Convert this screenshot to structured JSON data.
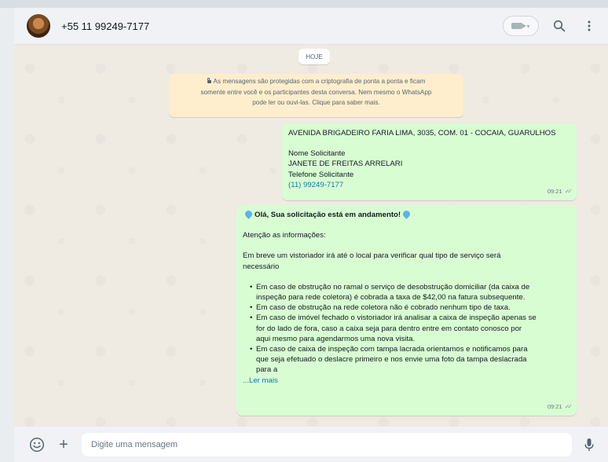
{
  "header": {
    "contact_name": "+55 11 99249-7177",
    "icons": [
      "avatar",
      "video-call-icon",
      "chevron-down-icon",
      "search-icon",
      "menu-icon"
    ]
  },
  "chat": {
    "date_chip": "HOJE",
    "encryption_notice": {
      "line1": "As mensagens são protegidas com a criptografia de ponta a ponta e ficam",
      "line2": "somente entre você e os participantes desta conversa. Nem mesmo o WhatsApp",
      "line3": "pode ler ou ouvi-las. Clique para saber mais."
    },
    "message1": {
      "line1": "AVENIDA BRIGADEIRO FARIA LIMA, 3035, COM. 01 - COCAIA, GUARULHOS",
      "line2": "Nome Solicitante",
      "line3": "JANETE DE FREITAS ARRELARI",
      "line4": "Telefone Solicitante",
      "phone_link": "(11) 99249-7177",
      "time": "09:21"
    },
    "message2": {
      "title": "Olá, Sua solicitação está em andamento!",
      "attention": "Atenção as informações:",
      "para1_line1": "Em breve um vistoriador irá até o local para verificar qual tipo de serviço será",
      "para1_line2": "necessário",
      "bullets": [
        {
          "l1": "Em caso de obstrução no ramal o serviço de desobstrução domiciliar (da caixa de",
          "l2": "inspeção para rede coletora) é cobrada a taxa de $42,00 na fatura subsequente."
        },
        {
          "l1": "Em caso de obstrução na rede coletora não é cobrado nenhum tipo de taxa."
        },
        {
          "l1": "Em caso de imóvel fechado o vistoriador irá analisar a caixa de inspeção apenas se",
          "l2": "for do lado de fora, caso a caixa seja para dentro entre em contato conosco por",
          "l3": "aqui mesmo para agendarmos uma nova visita."
        },
        {
          "l1": "Em caso de caixa de inspeção com tampa lacrada orientamos e notificamos para",
          "l2": "que seja efetuado o deslacre primeiro e nos envie uma foto da tampa deslacrada",
          "l3": "para a"
        }
      ],
      "read_more": "...Ler mais",
      "time": "09:21"
    }
  },
  "footer": {
    "input_placeholder": "Digite uma mensagem",
    "icons": [
      "emoji-icon",
      "plus-icon",
      "mic-icon"
    ]
  },
  "colors": {
    "outgoing_bubble": "#d9fdd3",
    "chat_background": "#efeae2",
    "link": "#027eb5",
    "encryption_bg": "#ffeecd"
  }
}
